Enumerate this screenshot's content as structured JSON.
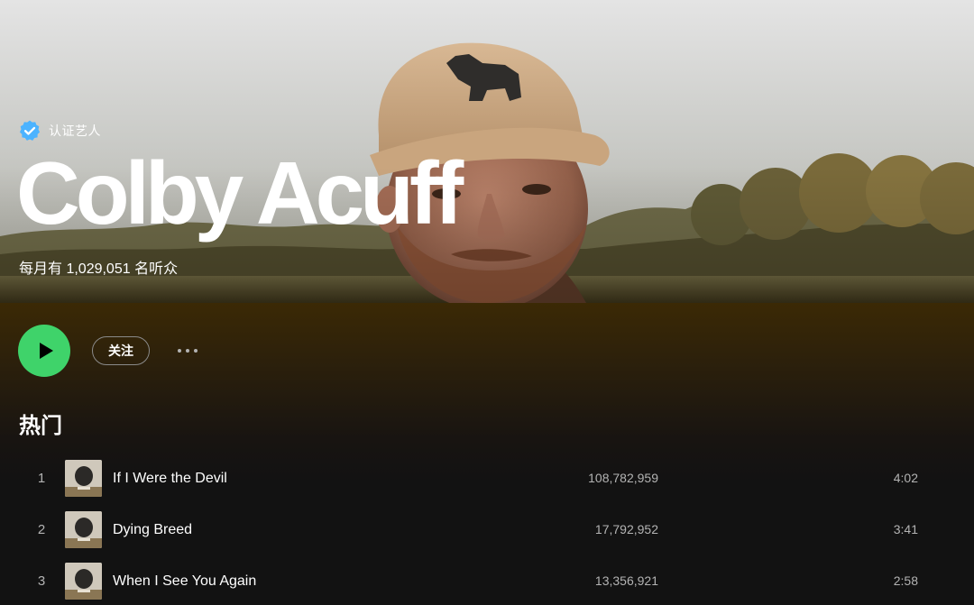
{
  "artist": {
    "verified_label": "认证艺人",
    "name": "Colby Acuff",
    "monthly_listeners": "每月有 1,029,051 名听众"
  },
  "actions": {
    "play_icon": "play-icon",
    "follow_label": "关注",
    "more_icon": "more-horizontal-icon"
  },
  "popular": {
    "title": "热门",
    "tracks": [
      {
        "number": "1",
        "title": "If I Were the Devil",
        "plays": "108,782,959",
        "duration": "4:02"
      },
      {
        "number": "2",
        "title": "Dying Breed",
        "plays": "17,792,952",
        "duration": "3:41"
      },
      {
        "number": "3",
        "title": "When I See You Again",
        "plays": "13,356,921",
        "duration": "2:58"
      }
    ]
  },
  "colors": {
    "accent_green": "#3fd36a",
    "verified_blue": "#4cb3ff",
    "background": "#121212",
    "secondary_text": "#b3b3b3"
  }
}
